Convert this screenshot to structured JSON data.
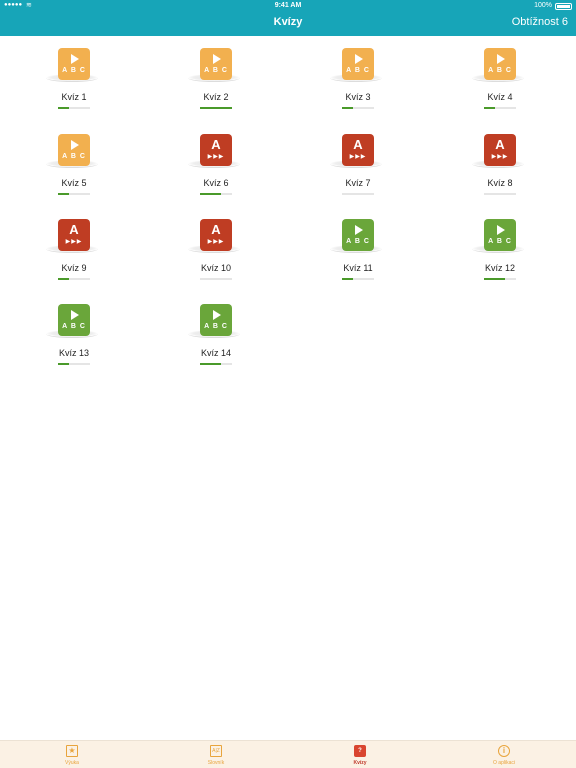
{
  "status": {
    "time": "9:41 AM",
    "battery": "100%"
  },
  "header": {
    "title": "Kvízy",
    "right_button": "Obtížnost 6"
  },
  "quizzes": [
    {
      "label": "Kvíz 1",
      "type": "play",
      "color": "#f2b04f",
      "progress": 0.35
    },
    {
      "label": "Kvíz 2",
      "type": "play",
      "color": "#f2b04f",
      "progress": 1.0
    },
    {
      "label": "Kvíz 3",
      "type": "play",
      "color": "#f2b04f",
      "progress": 0.35
    },
    {
      "label": "Kvíz 4",
      "type": "play",
      "color": "#f2b04f",
      "progress": 0.35
    },
    {
      "label": "Kvíz 5",
      "type": "play",
      "color": "#f2b04f",
      "progress": 0.35
    },
    {
      "label": "Kvíz 6",
      "type": "letter",
      "color": "#bf3d23",
      "progress": 0.65
    },
    {
      "label": "Kvíz 7",
      "type": "letter",
      "color": "#bf3d23",
      "progress": 0.0
    },
    {
      "label": "Kvíz 8",
      "type": "letter",
      "color": "#bf3d23",
      "progress": 0.0
    },
    {
      "label": "Kvíz 9",
      "type": "letter",
      "color": "#bf3d23",
      "progress": 0.35
    },
    {
      "label": "Kvíz 10",
      "type": "letter",
      "color": "#bf3d23",
      "progress": 0.0
    },
    {
      "label": "Kvíz 11",
      "type": "play",
      "color": "#6aa63a",
      "progress": 0.35
    },
    {
      "label": "Kvíz 12",
      "type": "play",
      "color": "#6aa63a",
      "progress": 0.65
    },
    {
      "label": "Kvíz 13",
      "type": "play",
      "color": "#6aa63a",
      "progress": 0.35
    },
    {
      "label": "Kvíz 14",
      "type": "play",
      "color": "#6aa63a",
      "progress": 0.65
    }
  ],
  "icon_text": {
    "abc": "A B C",
    "letter": "A",
    "arrows": "▶▶▶"
  },
  "tabs": [
    {
      "label": "Výuka",
      "icon": "star-icon"
    },
    {
      "label": "Slovník",
      "icon": "dictionary-icon"
    },
    {
      "label": "Kvízy",
      "icon": "quiz-icon"
    },
    {
      "label": "O aplikaci",
      "icon": "info-icon"
    }
  ]
}
